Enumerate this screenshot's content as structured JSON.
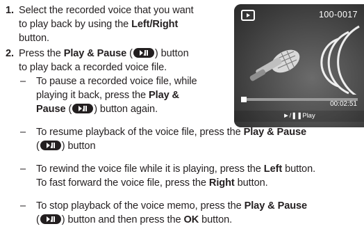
{
  "steps": [
    {
      "number": "1.",
      "line1": "Select the recorded voice that you want",
      "line2": "to play back by using the ",
      "left": "Left",
      "slash": "/",
      "right": "Right",
      "line3": "button."
    },
    {
      "number": "2.",
      "line1a": "Press the ",
      "play_pause": "Play & Pause",
      "line1b": " (",
      "line1c": ") button",
      "line2": "to play back a recorded voice file."
    }
  ],
  "bullets": [
    {
      "dash": "–",
      "l1": "To pause a recorded voice file, while",
      "l2a": "playing it back, press the ",
      "play": "Play &",
      "pause": "Pause",
      "l3a": " (",
      "l3b": ") button again."
    },
    {
      "dash": "–",
      "l1a": "To resume playback of the voice file, press the ",
      "play_pause": "Play & Pause",
      "l2a": "(",
      "l2b": ") button"
    },
    {
      "dash": "–",
      "l1a": "To rewind the voice file while it is playing, press the ",
      "left": "Left",
      "l1b": " button.",
      "l2a": "To fast forward the voice file, press the ",
      "right": "Right",
      "l2b": " button."
    },
    {
      "dash": "–",
      "l1a": "To stop playback of the voice memo, press the ",
      "play_pause": "Play & Pause",
      "l2a": "(",
      "l2b": ") button and then press the ",
      "ok": "OK",
      "l2c": " button."
    }
  ],
  "screen": {
    "file_number": "100-0017",
    "elapsed": "00:02:51",
    "hint_symbols": "►/❚❚",
    "hint_label": "Play",
    "progress_fraction": 0.04,
    "mode_icon": "playback-mode-icon"
  },
  "icons": {
    "play_pause": "play-pause-button-icon"
  }
}
